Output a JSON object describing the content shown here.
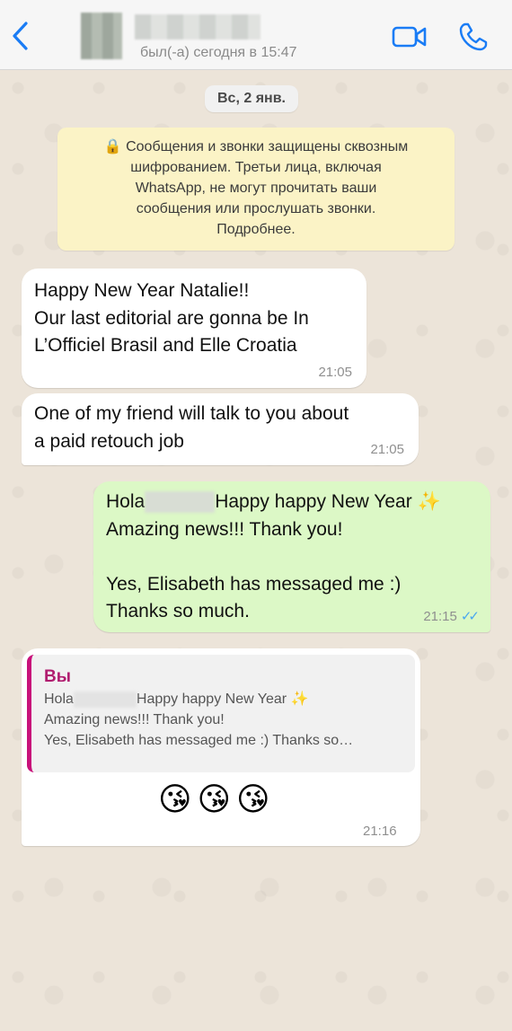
{
  "header": {
    "last_seen": "был(-а) сегодня в 15:47",
    "back_icon": "chevron-left-icon",
    "video_icon": "video-camera-icon",
    "call_icon": "phone-icon",
    "accent_color": "#1a7cf5"
  },
  "chat": {
    "date_label": "Вс, 2 янв.",
    "encryption_notice": {
      "lines": [
        "🔒 Сообщения и звонки защищены сквозным",
        "шифрованием. Третьи лица, включая",
        "WhatsApp, не могут прочитать ваши",
        "сообщения или прослушать звонки.",
        "Подробнее."
      ]
    },
    "messages": [
      {
        "direction": "incoming",
        "lines": [
          "Happy New Year Natalie!!",
          "Our last editorial are gonna be In",
          "L’Officiel Brasil and Elle Croatia"
        ],
        "time": "21:05"
      },
      {
        "direction": "incoming",
        "lines": [
          "One of my friend will talk to you about",
          "a paid retouch job"
        ],
        "time": "21:05"
      },
      {
        "direction": "outgoing",
        "line1_prefix": "Hola",
        "line1_suffix": "Happy happy New Year ✨",
        "lines": [
          "Amazing news!!! Thank you!",
          "",
          "Yes, Elisabeth has messaged me :)",
          "Thanks so much."
        ],
        "time": "21:15",
        "status": "read"
      },
      {
        "direction": "incoming",
        "quote": {
          "author": "Вы",
          "line1_prefix": "Hola",
          "line1_suffix": "Happy happy New Year ✨",
          "line2": "Amazing news!!! Thank you!",
          "line3": "Yes, Elisabeth has messaged me :) Thanks so…"
        },
        "emojis": "😘😘😘",
        "time": "21:16"
      }
    ]
  }
}
